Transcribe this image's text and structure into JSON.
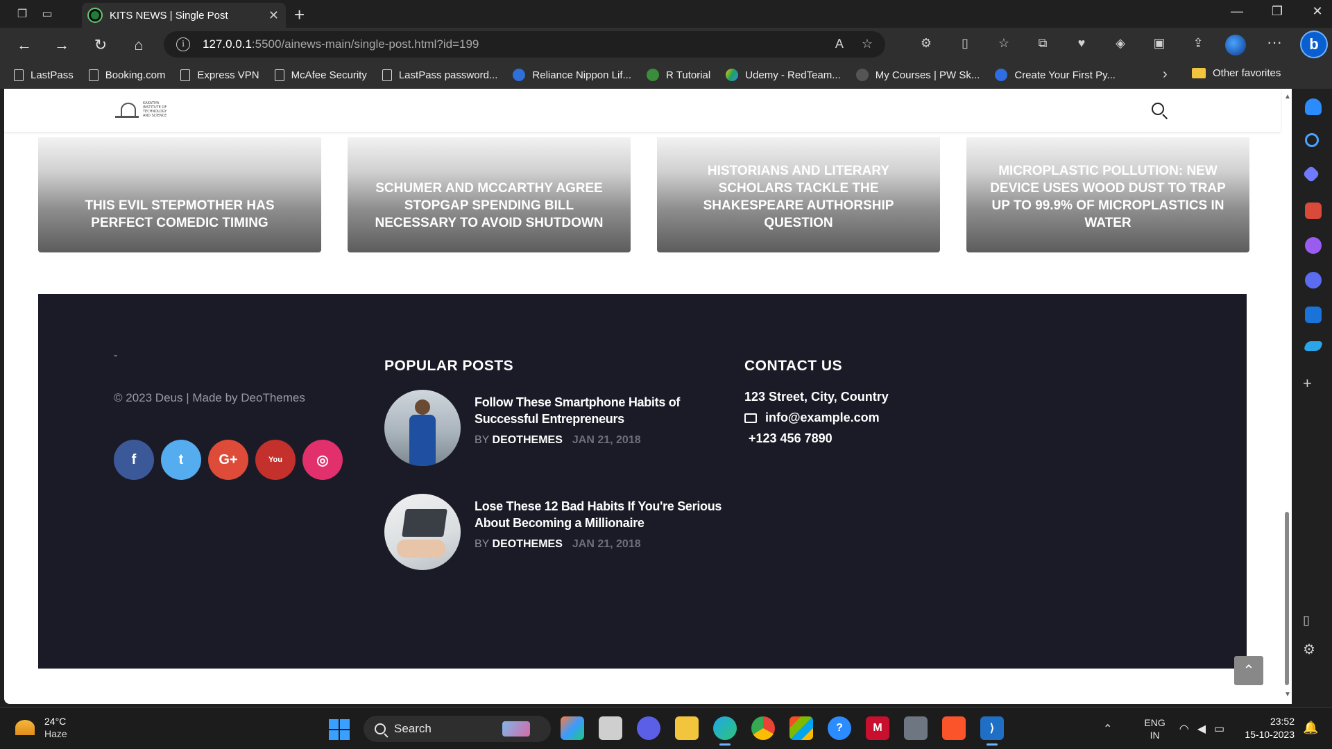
{
  "browser": {
    "tab_title": "KITS NEWS | Single Post",
    "url_host": "127.0.0.1",
    "url_path": ":5500/ainews-main/single-post.html?id=199",
    "bookmarks": [
      "LastPass",
      "Booking.com",
      "Express VPN",
      "McAfee Security",
      "LastPass password...",
      "Reliance Nippon Lif...",
      "R Tutorial",
      "Udemy - RedTeam...",
      "My Courses | PW Sk...",
      "Create Your First Py..."
    ],
    "other_favorites": "Other favorites"
  },
  "site": {
    "logo_text": "KAKATIYA INSTITUTE OF TECHNOLOGY AND SCIENCE"
  },
  "related_posts": [
    "This Evil Stepmother Has Perfect Comedic Timing",
    "Schumer and McCarthy Agree Stopgap Spending Bill Necessary to Avoid Shutdown",
    "Historians and Literary Scholars Tackle the Shakespeare Authorship Question",
    "Microplastic Pollution: New Device Uses Wood Dust to Trap up to 99.9% of Microplastics in Water"
  ],
  "footer": {
    "dash": "-",
    "copyright": "© 2023 Deus | Made by DeoThemes",
    "socials": [
      {
        "name": "facebook",
        "glyph": "f",
        "color": "#3b5998"
      },
      {
        "name": "twitter",
        "glyph": "t",
        "color": "#55acee"
      },
      {
        "name": "google-plus",
        "glyph": "G+",
        "color": "#de4b39"
      },
      {
        "name": "youtube",
        "glyph": "You",
        "color": "#c4302b"
      },
      {
        "name": "instagram",
        "glyph": "◎",
        "color": "#e1306c"
      }
    ],
    "popular_heading": "POPULAR POSTS",
    "posts": [
      {
        "title": "Follow These Smartphone Habits of Successful Entrepreneurs",
        "by": "BY",
        "author": "DEOTHEMES",
        "date": "JAN 21, 2018"
      },
      {
        "title": "Lose These 12 Bad Habits If You're Serious About Becoming a Millionaire",
        "by": "BY",
        "author": "DEOTHEMES",
        "date": "JAN 21, 2018"
      }
    ],
    "contact_heading": "CONTACT US",
    "address": "123 Street, City, Country",
    "email": "info@example.com",
    "phone": "+123 456 7890"
  },
  "taskbar": {
    "temp": "24°C",
    "condition": "Haze",
    "search": "Search",
    "lang_top": "ENG",
    "lang_bottom": "IN",
    "time": "23:52",
    "date": "15-10-2023"
  },
  "colors": {
    "footer_bg": "#1b1b27",
    "accent_blue": "#0a5fd0"
  }
}
